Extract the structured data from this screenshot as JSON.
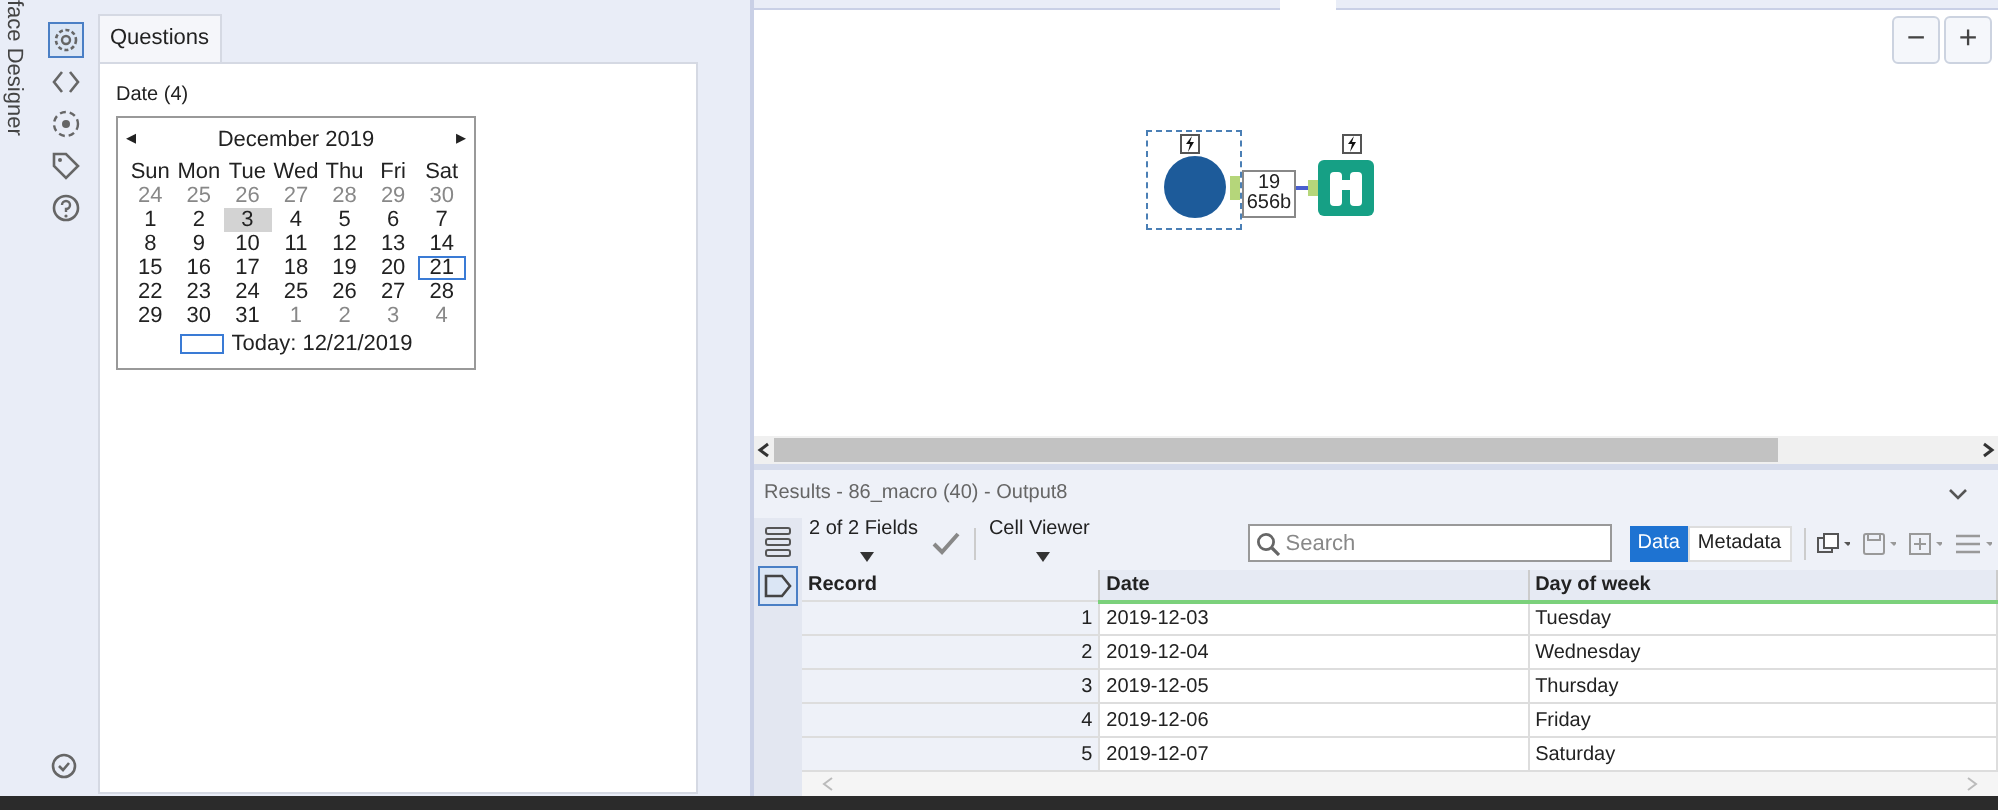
{
  "side_title": "face Designer",
  "tools": [
    {
      "selected": true
    },
    {
      "selected": false
    },
    {
      "selected": false
    },
    {
      "selected": false
    },
    {
      "selected": false
    }
  ],
  "questions_tab": "Questions",
  "date_label": "Date (4)",
  "calendar": {
    "month": "December 2019",
    "prev": "◂",
    "next": "▸",
    "weekdays": [
      "Sun",
      "Mon",
      "Tue",
      "Wed",
      "Thu",
      "Fri",
      "Sat"
    ],
    "days": [
      {
        "d": "24",
        "muted": true,
        "selected": false,
        "today": false
      },
      {
        "d": "25",
        "muted": true,
        "selected": false,
        "today": false
      },
      {
        "d": "26",
        "muted": true,
        "selected": false,
        "today": false
      },
      {
        "d": "27",
        "muted": true,
        "selected": false,
        "today": false
      },
      {
        "d": "28",
        "muted": true,
        "selected": false,
        "today": false
      },
      {
        "d": "29",
        "muted": true,
        "selected": false,
        "today": false
      },
      {
        "d": "30",
        "muted": true,
        "selected": false,
        "today": false
      },
      {
        "d": "1",
        "muted": false,
        "selected": false,
        "today": false
      },
      {
        "d": "2",
        "muted": false,
        "selected": false,
        "today": false
      },
      {
        "d": "3",
        "muted": false,
        "selected": true,
        "today": false
      },
      {
        "d": "4",
        "muted": false,
        "selected": false,
        "today": false
      },
      {
        "d": "5",
        "muted": false,
        "selected": false,
        "today": false
      },
      {
        "d": "6",
        "muted": false,
        "selected": false,
        "today": false
      },
      {
        "d": "7",
        "muted": false,
        "selected": false,
        "today": false
      },
      {
        "d": "8",
        "muted": false,
        "selected": false,
        "today": false
      },
      {
        "d": "9",
        "muted": false,
        "selected": false,
        "today": false
      },
      {
        "d": "10",
        "muted": false,
        "selected": false,
        "today": false
      },
      {
        "d": "11",
        "muted": false,
        "selected": false,
        "today": false
      },
      {
        "d": "12",
        "muted": false,
        "selected": false,
        "today": false
      },
      {
        "d": "13",
        "muted": false,
        "selected": false,
        "today": false
      },
      {
        "d": "14",
        "muted": false,
        "selected": false,
        "today": false
      },
      {
        "d": "15",
        "muted": false,
        "selected": false,
        "today": false
      },
      {
        "d": "16",
        "muted": false,
        "selected": false,
        "today": false
      },
      {
        "d": "17",
        "muted": false,
        "selected": false,
        "today": false
      },
      {
        "d": "18",
        "muted": false,
        "selected": false,
        "today": false
      },
      {
        "d": "19",
        "muted": false,
        "selected": false,
        "today": false
      },
      {
        "d": "20",
        "muted": false,
        "selected": false,
        "today": false
      },
      {
        "d": "21",
        "muted": false,
        "selected": false,
        "today": true
      },
      {
        "d": "22",
        "muted": false,
        "selected": false,
        "today": false
      },
      {
        "d": "23",
        "muted": false,
        "selected": false,
        "today": false
      },
      {
        "d": "24",
        "muted": false,
        "selected": false,
        "today": false
      },
      {
        "d": "25",
        "muted": false,
        "selected": false,
        "today": false
      },
      {
        "d": "26",
        "muted": false,
        "selected": false,
        "today": false
      },
      {
        "d": "27",
        "muted": false,
        "selected": false,
        "today": false
      },
      {
        "d": "28",
        "muted": false,
        "selected": false,
        "today": false
      },
      {
        "d": "29",
        "muted": false,
        "selected": false,
        "today": false
      },
      {
        "d": "30",
        "muted": false,
        "selected": false,
        "today": false
      },
      {
        "d": "31",
        "muted": false,
        "selected": false,
        "today": false
      },
      {
        "d": "1",
        "muted": true,
        "selected": false,
        "today": false
      },
      {
        "d": "2",
        "muted": true,
        "selected": false,
        "today": false
      },
      {
        "d": "3",
        "muted": true,
        "selected": false,
        "today": false
      },
      {
        "d": "4",
        "muted": true,
        "selected": false,
        "today": false
      }
    ],
    "today_text": "Today: 12/21/2019"
  },
  "zoom_buttons": [
    "−",
    "+"
  ],
  "connection": {
    "records": "19",
    "size": "656b"
  },
  "results": {
    "title": "Results - 86_macro (40) - Output8",
    "fields": "2 of 2 Fields",
    "cell_viewer": "Cell Viewer",
    "search_placeholder": "Search",
    "views": [
      {
        "label": "Data",
        "selected": true
      },
      {
        "label": "Metadata",
        "selected": false
      }
    ],
    "columns": [
      "Record",
      "Date",
      "Day of week"
    ],
    "rows": [
      [
        "1",
        "2019-12-03",
        "Tuesday"
      ],
      [
        "2",
        "2019-12-04",
        "Wednesday"
      ],
      [
        "3",
        "2019-12-05",
        "Thursday"
      ],
      [
        "4",
        "2019-12-06",
        "Friday"
      ],
      [
        "5",
        "2019-12-07",
        "Saturday"
      ]
    ]
  }
}
